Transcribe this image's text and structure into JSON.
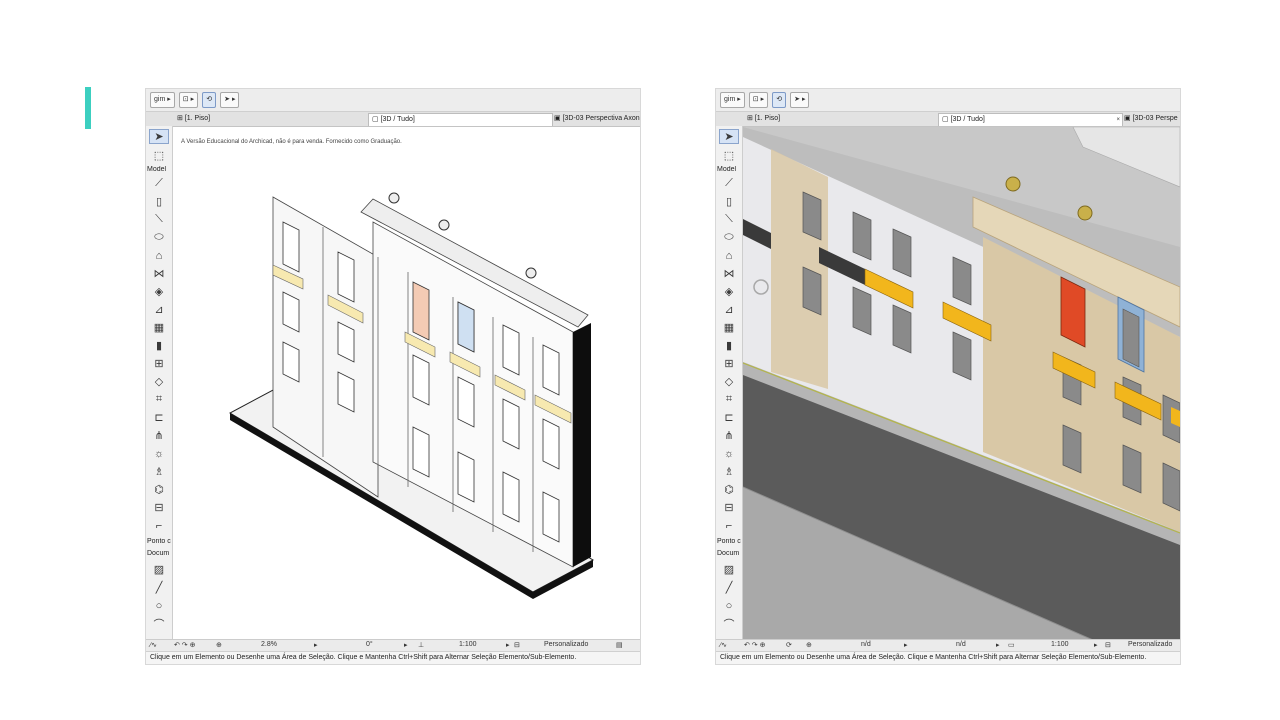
{
  "left_window": {
    "toolbar": {
      "layer_button": "gim",
      "view_button": "",
      "arrow_icon": "arrow-tool-icon"
    },
    "tabs": {
      "floor_plan": "[1. Piso]",
      "view_3d": "[3D / Tudo]",
      "perspective": "[3D-03 Perspectiva Axon"
    },
    "toolbox": {
      "section_model": "Model",
      "section_point": "Ponto c",
      "section_docum": "Docum"
    },
    "info_message": "A Versão Educacional do Archicad, não é para venda. Fornecido como Graduação.",
    "zoombar": {
      "zoom": "2.8%",
      "angle": "0°",
      "scale": "1:100",
      "model_view": "Personalizado"
    },
    "status": "Clique em um Elemento ou Desenhe uma Área de Seleção. Clique e Mantenha Ctrl+Shift para Alternar Seleção Elemento/Sub-Elemento."
  },
  "right_window": {
    "toolbar": {
      "layer_button": "gim",
      "view_button": "",
      "arrow_icon": "arrow-tool-icon"
    },
    "tabs": {
      "floor_plan": "[1. Piso]",
      "view_3d": "[3D / Tudo]",
      "close": "×",
      "perspective": "[3D-03 Perspe"
    },
    "toolbox": {
      "section_model": "Model",
      "section_point": "Ponto c",
      "section_docum": "Docum"
    },
    "zoombar": {
      "zoom": "n/d",
      "angle": "n/d",
      "scale": "1:100",
      "model_view": "Personalizado"
    },
    "status": "Clique em um Elemento ou Desenhe uma Área de Seleção. Clique e Mantenha Ctrl+Shift para Alternar Seleção Elemento/Sub-Elemento."
  },
  "colors": {
    "accent": "#3ccfc0",
    "facade_beige": "#d9c8a6",
    "facade_light": "#e9e9ec",
    "balcony_yellow": "#f2b61c",
    "window_red": "#e04a26",
    "window_blue": "#8fb2d6",
    "street_asphalt": "#5b5b5b"
  }
}
